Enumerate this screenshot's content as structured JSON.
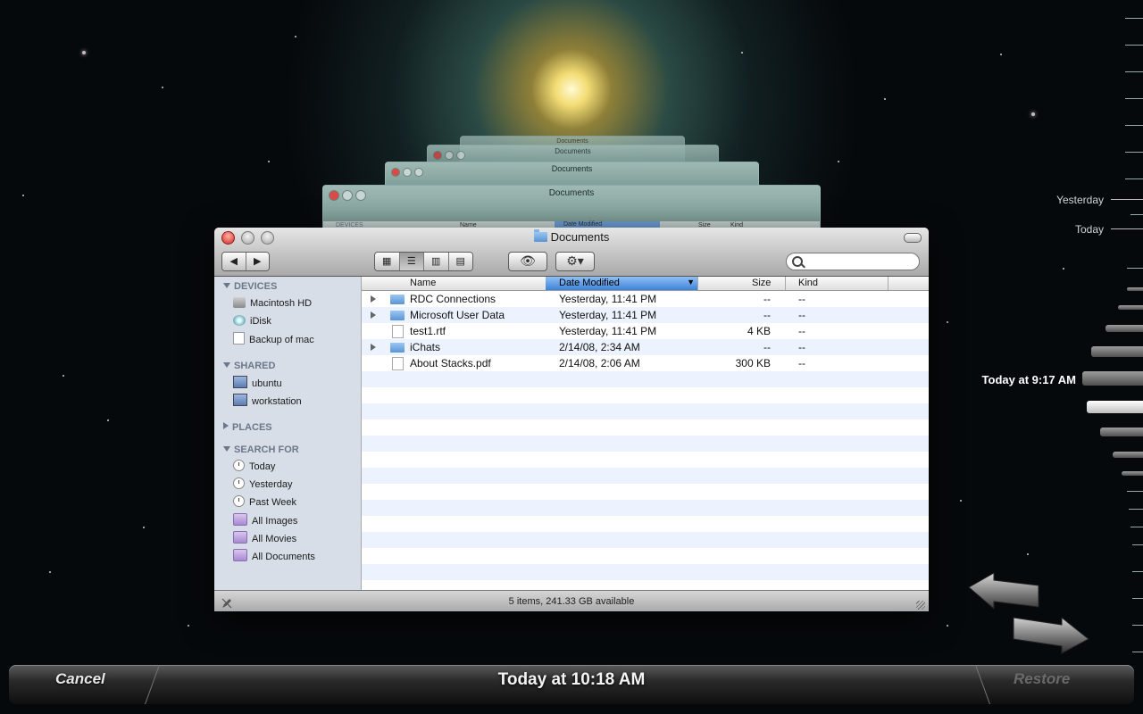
{
  "window": {
    "title": "Documents",
    "search_placeholder": ""
  },
  "ghost_windows": [
    {
      "title": "Documents"
    },
    {
      "title": "Documents"
    },
    {
      "title": "Documents"
    }
  ],
  "ghost_front": {
    "sidebar_header": "DEVICES",
    "columns": [
      "Name",
      "Date Modified",
      "Size",
      "Kind"
    ]
  },
  "sidebar": {
    "devices_header": "DEVICES",
    "devices": [
      "Macintosh HD",
      "iDisk",
      "Backup of mac"
    ],
    "shared_header": "SHARED",
    "shared": [
      "ubuntu",
      "workstation"
    ],
    "places_header": "PLACES",
    "search_header": "SEARCH FOR",
    "search": [
      "Today",
      "Yesterday",
      "Past Week",
      "All Images",
      "All Movies",
      "All Documents"
    ]
  },
  "columns": {
    "name": "Name",
    "date": "Date Modified",
    "size": "Size",
    "kind": "Kind"
  },
  "files": [
    {
      "name": "RDC Connections",
      "date": "Yesterday, 11:41 PM",
      "size": "--",
      "kind": "--",
      "type": "folder"
    },
    {
      "name": "Microsoft User Data",
      "date": "Yesterday, 11:41 PM",
      "size": "--",
      "kind": "--",
      "type": "folder"
    },
    {
      "name": "test1.rtf",
      "date": "Yesterday, 11:41 PM",
      "size": "4 KB",
      "kind": "--",
      "type": "file"
    },
    {
      "name": "iChats",
      "date": "2/14/08, 2:34 AM",
      "size": "--",
      "kind": "--",
      "type": "folder"
    },
    {
      "name": "About Stacks.pdf",
      "date": "2/14/08, 2:06 AM",
      "size": "300 KB",
      "kind": "--",
      "type": "file"
    }
  ],
  "status": "5 items, 241.33 GB available",
  "timeline": {
    "yesterday": "Yesterday",
    "today": "Today",
    "current": "Today at 9:17 AM"
  },
  "bottom": {
    "cancel": "Cancel",
    "time": "Today at 10:18 AM",
    "restore": "Restore"
  },
  "colors": {
    "sort_header": "#3d82da",
    "sidebar_bg": "#d8dee7",
    "row_alt": "#edf3fe",
    "close_button": "#d42a20"
  }
}
